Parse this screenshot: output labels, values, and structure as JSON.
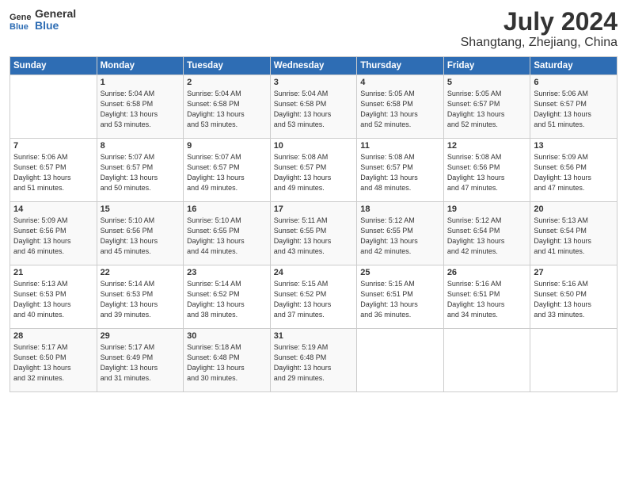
{
  "logo": {
    "general": "General",
    "blue": "Blue"
  },
  "title": "July 2024",
  "subtitle": "Shangtang, Zhejiang, China",
  "headers": [
    "Sunday",
    "Monday",
    "Tuesday",
    "Wednesday",
    "Thursday",
    "Friday",
    "Saturday"
  ],
  "weeks": [
    [
      {
        "day": "",
        "info": ""
      },
      {
        "day": "1",
        "info": "Sunrise: 5:04 AM\nSunset: 6:58 PM\nDaylight: 13 hours\nand 53 minutes."
      },
      {
        "day": "2",
        "info": "Sunrise: 5:04 AM\nSunset: 6:58 PM\nDaylight: 13 hours\nand 53 minutes."
      },
      {
        "day": "3",
        "info": "Sunrise: 5:04 AM\nSunset: 6:58 PM\nDaylight: 13 hours\nand 53 minutes."
      },
      {
        "day": "4",
        "info": "Sunrise: 5:05 AM\nSunset: 6:58 PM\nDaylight: 13 hours\nand 52 minutes."
      },
      {
        "day": "5",
        "info": "Sunrise: 5:05 AM\nSunset: 6:57 PM\nDaylight: 13 hours\nand 52 minutes."
      },
      {
        "day": "6",
        "info": "Sunrise: 5:06 AM\nSunset: 6:57 PM\nDaylight: 13 hours\nand 51 minutes."
      }
    ],
    [
      {
        "day": "7",
        "info": "Sunrise: 5:06 AM\nSunset: 6:57 PM\nDaylight: 13 hours\nand 51 minutes."
      },
      {
        "day": "8",
        "info": "Sunrise: 5:07 AM\nSunset: 6:57 PM\nDaylight: 13 hours\nand 50 minutes."
      },
      {
        "day": "9",
        "info": "Sunrise: 5:07 AM\nSunset: 6:57 PM\nDaylight: 13 hours\nand 49 minutes."
      },
      {
        "day": "10",
        "info": "Sunrise: 5:08 AM\nSunset: 6:57 PM\nDaylight: 13 hours\nand 49 minutes."
      },
      {
        "day": "11",
        "info": "Sunrise: 5:08 AM\nSunset: 6:57 PM\nDaylight: 13 hours\nand 48 minutes."
      },
      {
        "day": "12",
        "info": "Sunrise: 5:08 AM\nSunset: 6:56 PM\nDaylight: 13 hours\nand 47 minutes."
      },
      {
        "day": "13",
        "info": "Sunrise: 5:09 AM\nSunset: 6:56 PM\nDaylight: 13 hours\nand 47 minutes."
      }
    ],
    [
      {
        "day": "14",
        "info": "Sunrise: 5:09 AM\nSunset: 6:56 PM\nDaylight: 13 hours\nand 46 minutes."
      },
      {
        "day": "15",
        "info": "Sunrise: 5:10 AM\nSunset: 6:56 PM\nDaylight: 13 hours\nand 45 minutes."
      },
      {
        "day": "16",
        "info": "Sunrise: 5:10 AM\nSunset: 6:55 PM\nDaylight: 13 hours\nand 44 minutes."
      },
      {
        "day": "17",
        "info": "Sunrise: 5:11 AM\nSunset: 6:55 PM\nDaylight: 13 hours\nand 43 minutes."
      },
      {
        "day": "18",
        "info": "Sunrise: 5:12 AM\nSunset: 6:55 PM\nDaylight: 13 hours\nand 42 minutes."
      },
      {
        "day": "19",
        "info": "Sunrise: 5:12 AM\nSunset: 6:54 PM\nDaylight: 13 hours\nand 42 minutes."
      },
      {
        "day": "20",
        "info": "Sunrise: 5:13 AM\nSunset: 6:54 PM\nDaylight: 13 hours\nand 41 minutes."
      }
    ],
    [
      {
        "day": "21",
        "info": "Sunrise: 5:13 AM\nSunset: 6:53 PM\nDaylight: 13 hours\nand 40 minutes."
      },
      {
        "day": "22",
        "info": "Sunrise: 5:14 AM\nSunset: 6:53 PM\nDaylight: 13 hours\nand 39 minutes."
      },
      {
        "day": "23",
        "info": "Sunrise: 5:14 AM\nSunset: 6:52 PM\nDaylight: 13 hours\nand 38 minutes."
      },
      {
        "day": "24",
        "info": "Sunrise: 5:15 AM\nSunset: 6:52 PM\nDaylight: 13 hours\nand 37 minutes."
      },
      {
        "day": "25",
        "info": "Sunrise: 5:15 AM\nSunset: 6:51 PM\nDaylight: 13 hours\nand 36 minutes."
      },
      {
        "day": "26",
        "info": "Sunrise: 5:16 AM\nSunset: 6:51 PM\nDaylight: 13 hours\nand 34 minutes."
      },
      {
        "day": "27",
        "info": "Sunrise: 5:16 AM\nSunset: 6:50 PM\nDaylight: 13 hours\nand 33 minutes."
      }
    ],
    [
      {
        "day": "28",
        "info": "Sunrise: 5:17 AM\nSunset: 6:50 PM\nDaylight: 13 hours\nand 32 minutes."
      },
      {
        "day": "29",
        "info": "Sunrise: 5:17 AM\nSunset: 6:49 PM\nDaylight: 13 hours\nand 31 minutes."
      },
      {
        "day": "30",
        "info": "Sunrise: 5:18 AM\nSunset: 6:48 PM\nDaylight: 13 hours\nand 30 minutes."
      },
      {
        "day": "31",
        "info": "Sunrise: 5:19 AM\nSunset: 6:48 PM\nDaylight: 13 hours\nand 29 minutes."
      },
      {
        "day": "",
        "info": ""
      },
      {
        "day": "",
        "info": ""
      },
      {
        "day": "",
        "info": ""
      }
    ]
  ]
}
